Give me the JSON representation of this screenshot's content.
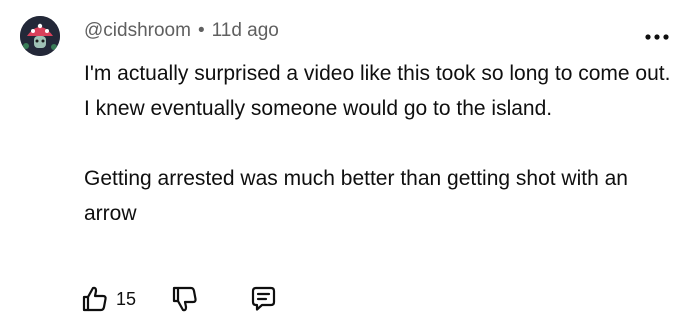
{
  "comment": {
    "username": "@cidshroom",
    "separator": "•",
    "timestamp": "11d ago",
    "paragraphs": [
      "I'm actually surprised a video like this took so long to come out. I knew eventually someone would go to the island.",
      "Getting arrested was much better than getting shot with an arrow"
    ],
    "likes": "15"
  },
  "icons": {
    "avatar": "mushroom-avatar",
    "more": "more-horizontal-icon",
    "like": "thumbs-up-icon",
    "dislike": "thumbs-down-icon",
    "reply": "reply-bubble-icon"
  },
  "colors": {
    "text": "#0f0f0f",
    "meta": "#606060",
    "mushroom_cap": "#d9415b"
  }
}
